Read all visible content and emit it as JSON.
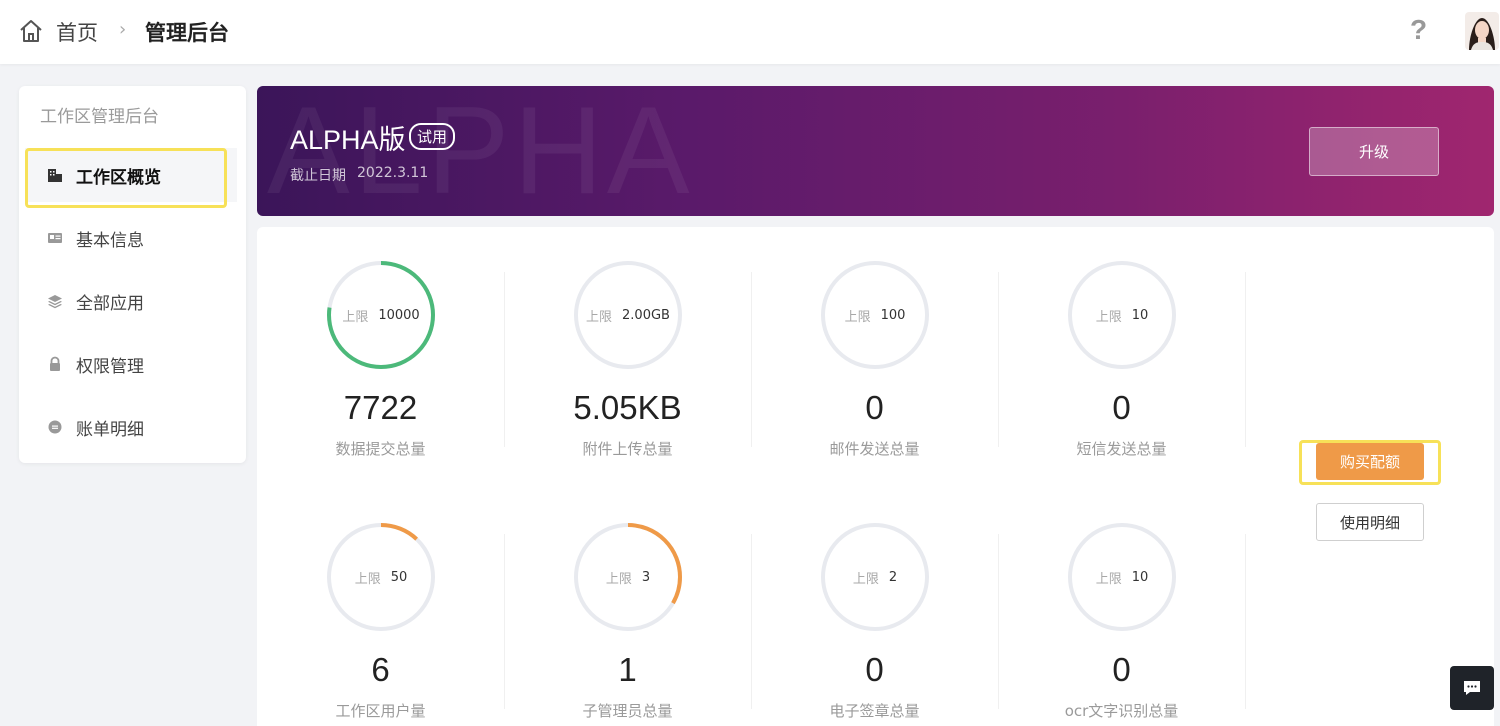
{
  "header": {
    "breadcrumb_home": "首页",
    "breadcrumb_separator": "›",
    "breadcrumb_current": "管理后台",
    "help_icon": "?"
  },
  "sidebar": {
    "title": "工作区管理后台",
    "items": [
      {
        "label": "工作区概览",
        "icon": "building-icon",
        "active": true
      },
      {
        "label": "基本信息",
        "icon": "id-card-icon",
        "active": false
      },
      {
        "label": "全部应用",
        "icon": "layers-icon",
        "active": false
      },
      {
        "label": "权限管理",
        "icon": "lock-icon",
        "active": false
      },
      {
        "label": "账单明细",
        "icon": "coin-icon",
        "active": false
      }
    ]
  },
  "banner": {
    "watermark": "ALPHA",
    "edition": "ALPHA版",
    "trial_badge": "试用",
    "deadline_label": "截止日期",
    "deadline_value": "2022.3.11",
    "upgrade_label": "升级"
  },
  "stats": {
    "limit_label": "上限",
    "items": [
      {
        "limit": "10000",
        "value": "7722",
        "name": "数据提交总量",
        "usage": 0.7722,
        "color": "#4cb97a"
      },
      {
        "limit": "2.00GB",
        "value": "5.05KB",
        "name": "附件上传总量",
        "usage": 0,
        "color": "#4cb97a"
      },
      {
        "limit": "100",
        "value": "0",
        "name": "邮件发送总量",
        "usage": 0,
        "color": "#4cb97a"
      },
      {
        "limit": "10",
        "value": "0",
        "name": "短信发送总量",
        "usage": 0,
        "color": "#4cb97a"
      },
      {
        "limit": "50",
        "value": "6",
        "name": "工作区用户量",
        "usage": 0.12,
        "color": "#ef9a48"
      },
      {
        "limit": "3",
        "value": "1",
        "name": "子管理员总量",
        "usage": 0.3333,
        "color": "#ef9a48"
      },
      {
        "limit": "2",
        "value": "0",
        "name": "电子签章总量",
        "usage": 0,
        "color": "#ef9a48"
      },
      {
        "limit": "10",
        "value": "0",
        "name": "ocr文字识别总量",
        "usage": 0,
        "color": "#ef9a48"
      }
    ]
  },
  "actions": {
    "buy_label": "购买配额",
    "detail_label": "使用明细"
  },
  "colors": {
    "ring_track": "#e8eaef",
    "highlight": "#f7e158",
    "buy": "#ef9a48"
  }
}
